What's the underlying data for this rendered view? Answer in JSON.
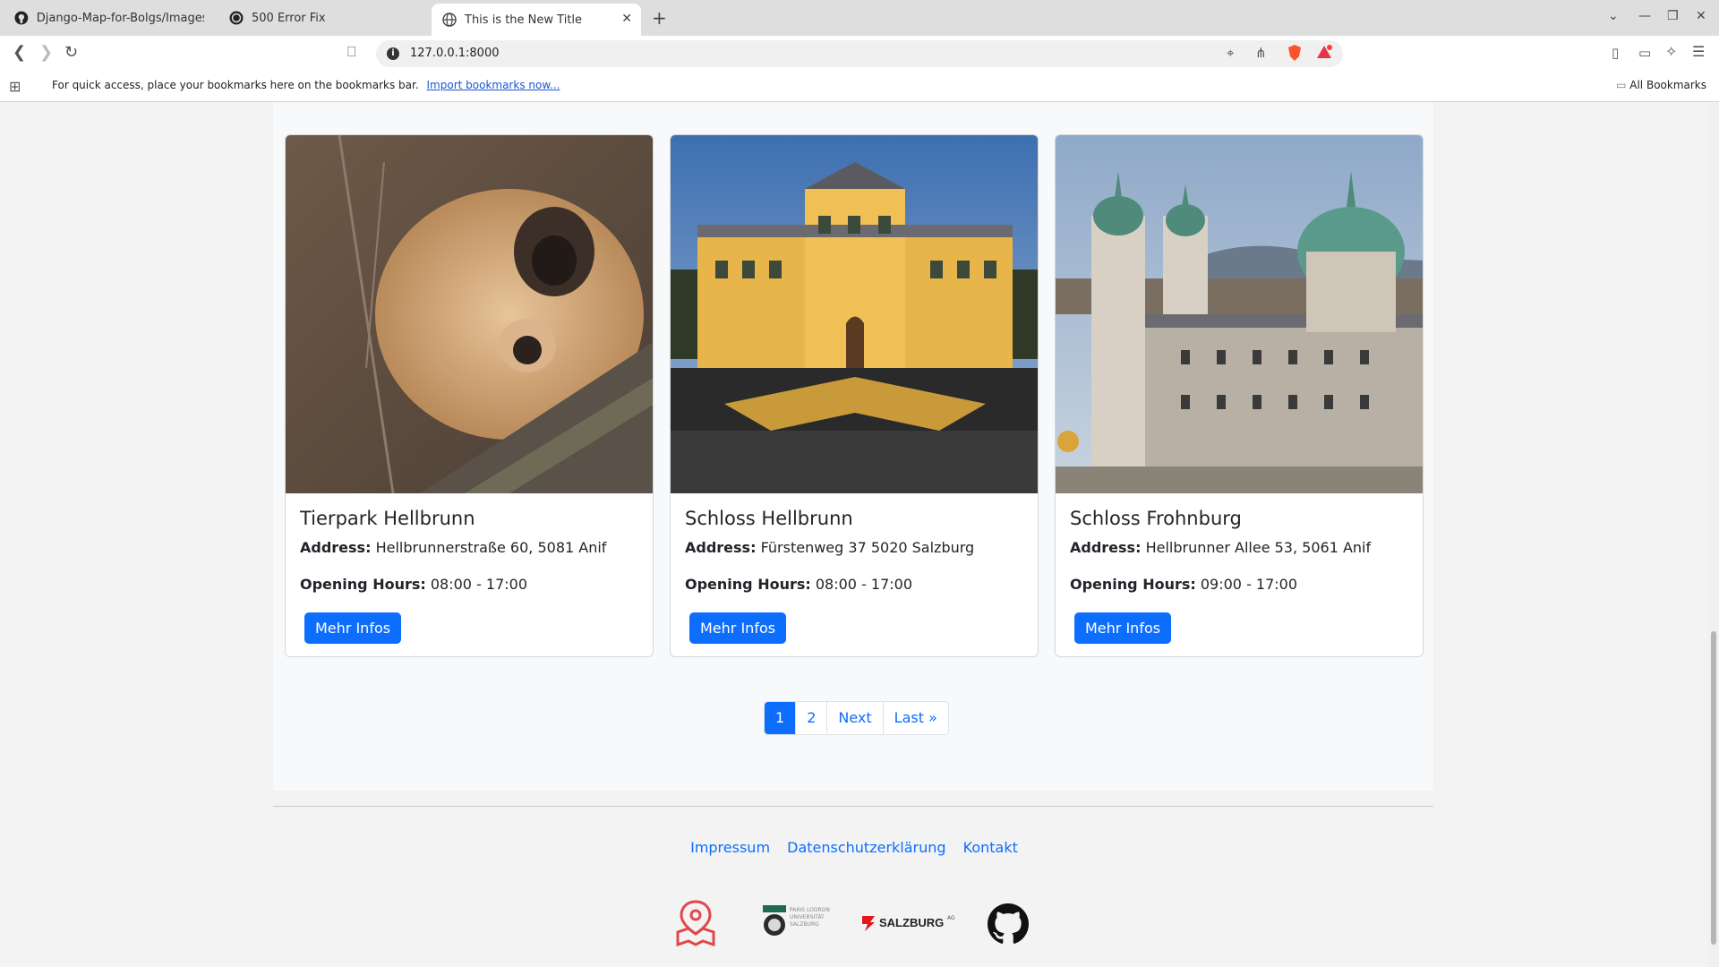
{
  "browser": {
    "tabs": [
      {
        "label": "Django-Map-for-Bolgs/Images a",
        "icon": "github-icon"
      },
      {
        "label": "500 Error Fix",
        "icon": "chatgpt-icon"
      },
      {
        "label": "This is the New Title",
        "icon": "globe-icon",
        "close": "✕"
      }
    ],
    "new_tab": "+",
    "url": "127.0.0.1:8000",
    "bookmarks_text": "For quick access, place your bookmarks here on the bookmarks bar.",
    "bookmarks_link": "Import bookmarks now...",
    "all_bookmarks": "All Bookmarks"
  },
  "cards": [
    {
      "title": "Tierpark Hellbrunn",
      "address_label": "Address:",
      "address": "Hellbrunnerstraße 60, 5081 Anif",
      "hours_label": "Opening Hours:",
      "hours": "08:00 - 17:00",
      "button": "Mehr Infos",
      "image": "gibbon-photo"
    },
    {
      "title": "Schloss Hellbrunn",
      "address_label": "Address:",
      "address": "Fürstenweg 37 5020 Salzburg",
      "hours_label": "Opening Hours:",
      "hours": "08:00 - 17:00",
      "button": "Mehr Infos",
      "image": "palace-photo"
    },
    {
      "title": "Schloss Frohnburg",
      "address_label": "Address:",
      "address": "Hellbrunner Allee 53, 5061 Anif",
      "hours_label": "Opening Hours:",
      "hours": "09:00 - 17:00",
      "button": "Mehr Infos",
      "image": "cathedral-photo"
    }
  ],
  "pagination": {
    "current": "1",
    "page2": "2",
    "next": "Next",
    "last": "Last »"
  },
  "footer": {
    "links": [
      "Impressum",
      "Datenschutzerklärung",
      "Kontakt"
    ],
    "logos": {
      "plus_text": "PARIS LODRON UNIVERSITÄT SALZBURG",
      "salzburg_text": "SALZBURG",
      "salzburg_suffix": "AG"
    }
  },
  "colors": {
    "primary": "#0d6efd"
  }
}
